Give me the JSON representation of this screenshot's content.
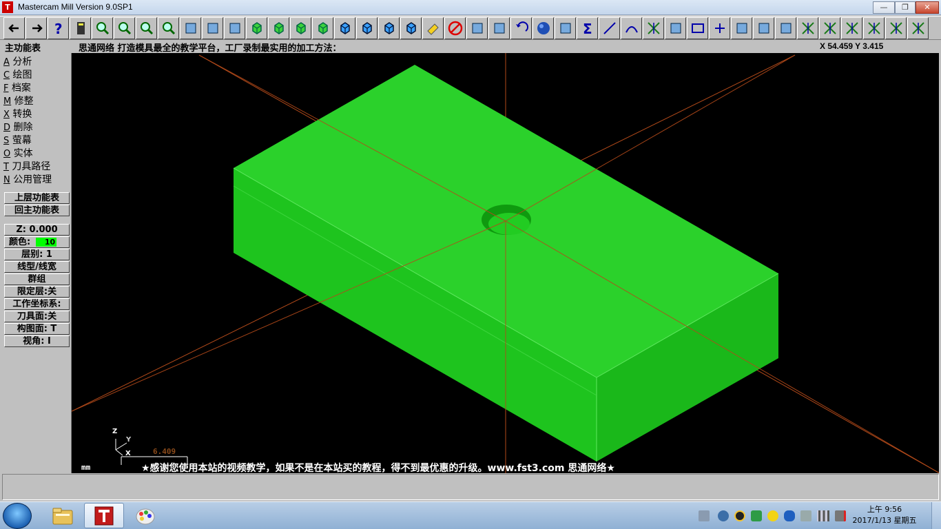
{
  "window": {
    "title": "Mastercam Mill Version 9.0SP1",
    "minimize": "—",
    "maximize": "❐",
    "close": "✕"
  },
  "toolbar": {
    "icons": [
      "back-arrow-icon",
      "forward-arrow-icon",
      "help-icon",
      "calculator-icon",
      "analyze-icon",
      "zoom-window-icon",
      "zoom-icon",
      "zoom-out-icon",
      "pan-icon",
      "autocursor-icon",
      "rotate-icon",
      "view-iso-icon",
      "view-front-icon",
      "view-side-icon",
      "view-top-icon",
      "cplane-top-icon",
      "cplane-front-icon",
      "cplane-side-icon",
      "cplane-3d-icon",
      "eraser-icon",
      "delete-icon",
      "transform-icon",
      "translate-icon",
      "undo-icon",
      "sphere-icon",
      "rotate-entity-icon",
      "sum-icon",
      "line-icon",
      "arc-icon",
      "trim-icon",
      "spline-icon",
      "rectangle-icon",
      "point-icon",
      "surface-icon",
      "solid-icon",
      "chain-icon",
      "break-icon",
      "trim-2-icon",
      "trim-3-icon",
      "extend-icon",
      "line-polar-icon",
      "line-angle-icon"
    ]
  },
  "infoline": {
    "menu_title": "主功能表",
    "prompt": "思通网络   打造模具最全的教学平台，工厂录制最实用的加工方法：",
    "coord": "X 54.459  Y 3.415"
  },
  "menu": {
    "items": [
      {
        "key": "A",
        "label": "分析"
      },
      {
        "key": "C",
        "label": "绘图"
      },
      {
        "key": "F",
        "label": "档案"
      },
      {
        "key": "M",
        "label": "修整"
      },
      {
        "key": "X",
        "label": "转换"
      },
      {
        "key": "D",
        "label": "删除"
      },
      {
        "key": "S",
        "label": "萤幕"
      },
      {
        "key": "O",
        "label": "实体"
      },
      {
        "key": "T",
        "label": "刀具路径"
      },
      {
        "key": "N",
        "label": "公用管理"
      }
    ],
    "back": "上层功能表",
    "main": "回主功能表",
    "z": "Z:  0.000",
    "color_label": "颜色:",
    "color_value": "10",
    "level": "层别: 1",
    "line_style": "线型/线宽",
    "group": "群组",
    "mask": "限定层:关",
    "wcs": "工作坐标系:",
    "tplane": "刀具面:关",
    "cplane": "构图面: T",
    "gview": "视角: I"
  },
  "viewport": {
    "scale_value": "6.409",
    "units": "mm",
    "ad_text": "★感谢您使用本站的视频教学，如果不是在本站买的教程，得不到最优惠的升级。www.fst3.com  思通网络★",
    "axis_z": "Z",
    "axis_y": "Y",
    "axis_x": "X",
    "solid_color": "#00ff00",
    "axis_color": "#b34a1a"
  },
  "taskbar": {
    "apps": [
      "windows-explorer-icon",
      "mastercam-icon",
      "paint-icon"
    ],
    "clock_time": "上午 9:56",
    "clock_date": "2017/1/13 星期五"
  }
}
